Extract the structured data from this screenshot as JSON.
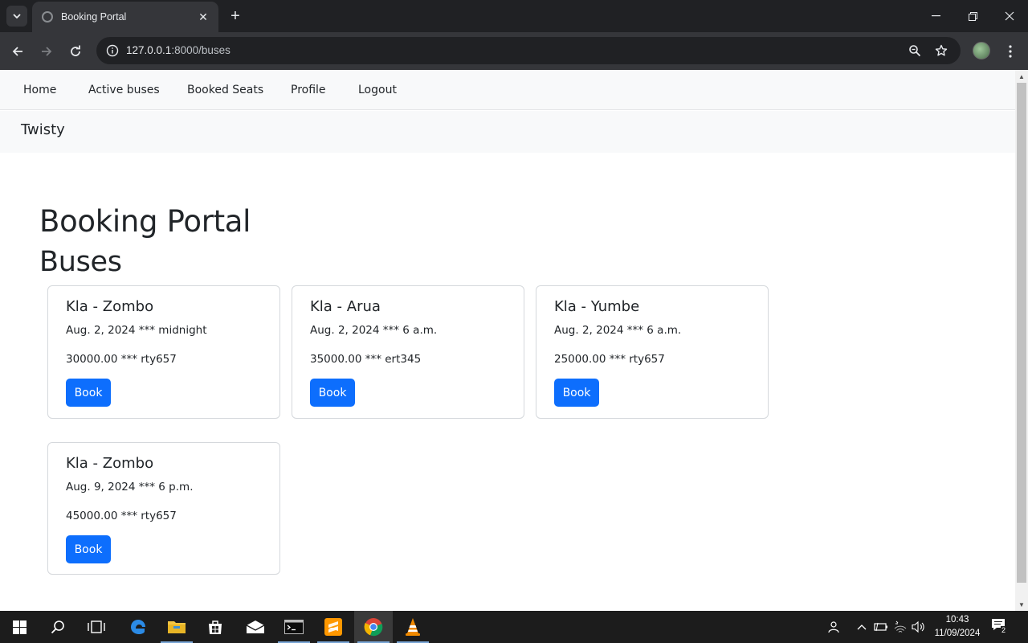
{
  "browser": {
    "tab_title": "Booking Portal",
    "url_host": "127.0.0.1",
    "url_path": ":8000/buses"
  },
  "nav": {
    "items": [
      "Home",
      "Active buses",
      "Booked Seats",
      "Profile",
      "Logout"
    ],
    "brand": "Twisty"
  },
  "page": {
    "title": "Booking Portal",
    "section": "Buses"
  },
  "buses": [
    {
      "route": "Kla - Zombo",
      "schedule": "Aug. 2, 2024 *** midnight",
      "fare_bus": "30000.00 *** rty657",
      "button": "Book"
    },
    {
      "route": "Kla - Arua",
      "schedule": "Aug. 2, 2024 *** 6 a.m.",
      "fare_bus": "35000.00 *** ert345",
      "button": "Book"
    },
    {
      "route": "Kla - Yumbe",
      "schedule": "Aug. 2, 2024 *** 6 a.m.",
      "fare_bus": "25000.00 *** rty657",
      "button": "Book"
    },
    {
      "route": "Kla - Zombo",
      "schedule": "Aug. 9, 2024 *** 6 p.m.",
      "fare_bus": "45000.00 *** rty657",
      "button": "Book"
    }
  ],
  "taskbar": {
    "time": "10:43",
    "date": "11/09/2024",
    "notification_count": "2"
  },
  "colors": {
    "primary": "#0d6efd",
    "navbar_bg": "#f8f9fa",
    "chrome_dark": "#202124"
  }
}
